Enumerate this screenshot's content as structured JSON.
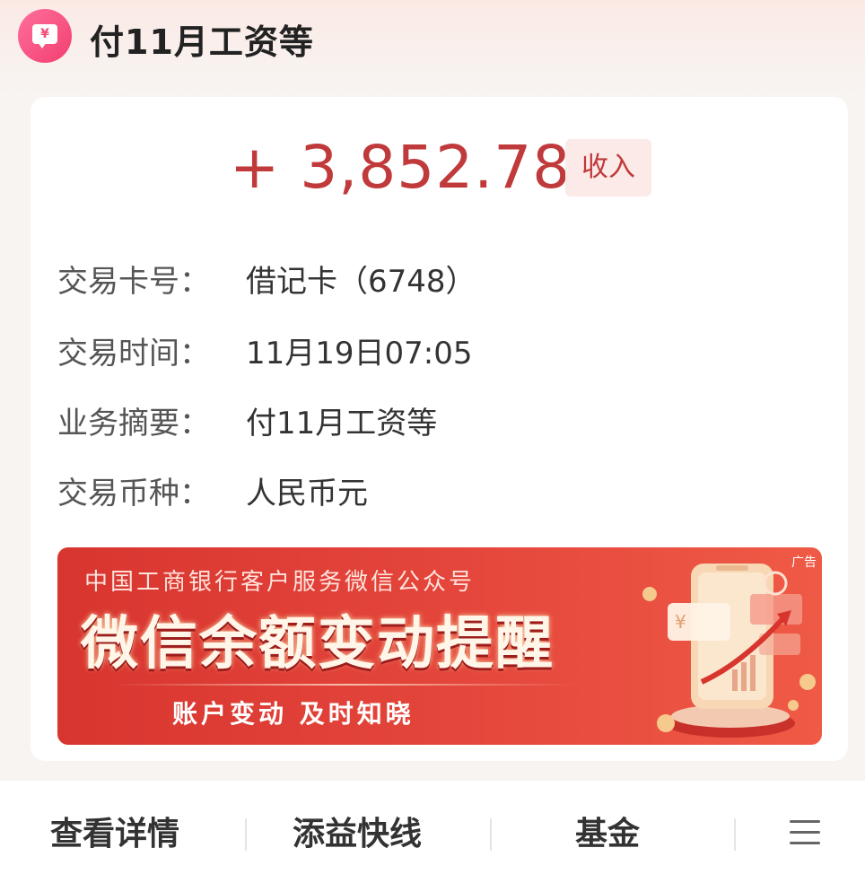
{
  "header": {
    "icon_glyph": "¥",
    "title": "付11月工资等"
  },
  "transaction": {
    "amount": "+ 3,852.78",
    "type_badge": "收入",
    "rows": [
      {
        "label": "交易卡号：",
        "value": "借记卡（6748）"
      },
      {
        "label": "交易时间：",
        "value": "11月19日07:05"
      },
      {
        "label": "业务摘要：",
        "value": "付11月工资等"
      },
      {
        "label": "交易币种：",
        "value": "人民币元"
      }
    ]
  },
  "banner": {
    "ad_tag": "广告",
    "line1": "中国工商银行客户服务微信公众号",
    "line2": "微信余额变动提醒",
    "line3": "账户变动 及时知晓"
  },
  "bottom_bar": {
    "items": [
      "查看详情",
      "添益快线",
      "基金"
    ],
    "menu_icon": "menu-icon"
  },
  "colors": {
    "amount": "#c0393b",
    "badge_bg": "#fbeae8",
    "banner_red": "#e5473c",
    "icon_pink": "#f23f70"
  }
}
